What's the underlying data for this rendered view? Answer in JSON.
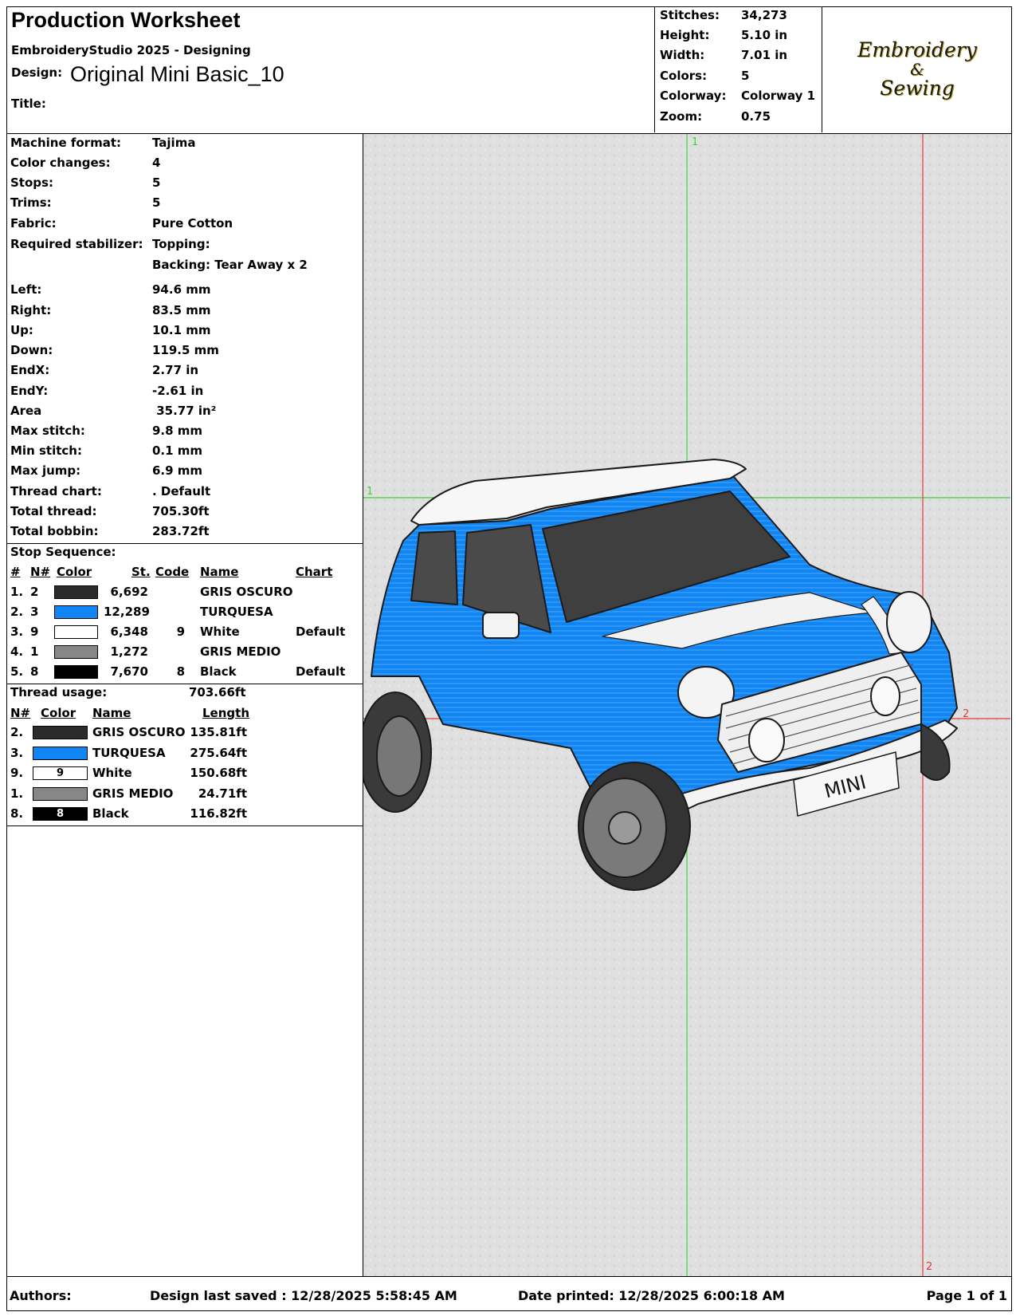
{
  "header": {
    "title": "Production Worksheet",
    "subtitle": "EmbroideryStudio 2025 - Designing",
    "design_label": "Design:",
    "design_name": "Original Mini Basic_10",
    "title_label": "Title:",
    "stats": [
      {
        "label": "Stitches:",
        "value": "34,273"
      },
      {
        "label": "Height:",
        "value": "5.10 in"
      },
      {
        "label": "Width:",
        "value": "7.01 in"
      },
      {
        "label": "Colors:",
        "value": "5"
      },
      {
        "label": "Colorway:",
        "value": "Colorway 1"
      },
      {
        "label": "Zoom:",
        "value": "0.75"
      }
    ],
    "logo_line1": "Embroidery",
    "logo_line2": "&",
    "logo_line3": "Sewing"
  },
  "details": [
    {
      "label": "Machine format:",
      "value": "Tajima"
    },
    {
      "label": "Color changes:",
      "value": "4"
    },
    {
      "label": "Stops:",
      "value": "5"
    },
    {
      "label": "Trims:",
      "value": "5"
    },
    {
      "label": "Fabric:",
      "value": "Pure Cotton"
    },
    {
      "label": "Required stabilizer:",
      "value": "Topping:"
    },
    {
      "label": "",
      "value": "Backing: Tear Away x 2"
    },
    {
      "label": "Left:",
      "value": "94.6 mm"
    },
    {
      "label": "Right:",
      "value": "83.5 mm"
    },
    {
      "label": "Up:",
      "value": "10.1 mm"
    },
    {
      "label": "Down:",
      "value": "119.5 mm"
    },
    {
      "label": "EndX:",
      "value": "2.77 in"
    },
    {
      "label": "EndY:",
      "value": "-2.61 in"
    },
    {
      "label": "Area",
      "value": " 35.77 in²"
    },
    {
      "label": "Max stitch:",
      "value": "9.8 mm"
    },
    {
      "label": "Min stitch:",
      "value": "0.1 mm"
    },
    {
      "label": "Max jump:",
      "value": "6.9 mm"
    },
    {
      "label": "Thread chart:",
      "value": ". Default"
    },
    {
      "label": "Total thread:",
      "value": "705.30ft"
    },
    {
      "label": "Total bobbin:",
      "value": "283.72ft"
    }
  ],
  "stop_sequence": {
    "title": "Stop Sequence:",
    "headers": {
      "num": "#",
      "n": "N#",
      "color": "Color",
      "st": "St.",
      "code": "Code",
      "name": "Name",
      "chart": "Chart"
    },
    "rows": [
      {
        "num": "1.",
        "n": "2",
        "color": "#2b2b2b",
        "st": "6,692",
        "code": "",
        "name": "GRIS OSCURO",
        "chart": ""
      },
      {
        "num": "2.",
        "n": "3",
        "color": "#1185f2",
        "st": "12,289",
        "code": "",
        "name": "TURQUESA",
        "chart": ""
      },
      {
        "num": "3.",
        "n": "9",
        "color": "#ffffff",
        "st": "6,348",
        "code": "9",
        "name": "White",
        "chart": "Default"
      },
      {
        "num": "4.",
        "n": "1",
        "color": "#878787",
        "st": "1,272",
        "code": "",
        "name": "GRIS MEDIO",
        "chart": ""
      },
      {
        "num": "5.",
        "n": "8",
        "color": "#000000",
        "st": "7,670",
        "code": "8",
        "name": "Black",
        "chart": "Default"
      }
    ]
  },
  "thread_usage": {
    "title": "Thread usage:",
    "total": "703.66ft",
    "headers": {
      "n": "N#",
      "color": "Color",
      "name": "Name",
      "length": "Length"
    },
    "rows": [
      {
        "n": "2.",
        "color": "#2b2b2b",
        "code": "",
        "name": "GRIS OSCURO",
        "length": "135.81ft"
      },
      {
        "n": "3.",
        "color": "#1185f2",
        "code": "",
        "name": "TURQUESA",
        "length": "275.64ft"
      },
      {
        "n": "9.",
        "color": "#ffffff",
        "code": "9",
        "name": "White",
        "length": "150.68ft"
      },
      {
        "n": "1.",
        "color": "#878787",
        "code": "",
        "name": "GRIS MEDIO",
        "length": "24.71ft"
      },
      {
        "n": "8.",
        "color": "#000000",
        "code": "8",
        "name": "Black",
        "length": "116.82ft"
      }
    ]
  },
  "preview": {
    "marker_top": "1",
    "marker_left": "1",
    "marker_right": "2",
    "marker_bottom": "2",
    "plate_text": "MINI",
    "accent_color": "#1185f2",
    "guide_green": "#3ad23a",
    "guide_red": "#e23b3b"
  },
  "footer": {
    "authors": "Authors:",
    "last_saved": "Design last saved : 12/28/2025 5:58:45 AM",
    "printed": "Date printed: 12/28/2025 6:00:18 AM",
    "page": "Page 1 of 1"
  }
}
